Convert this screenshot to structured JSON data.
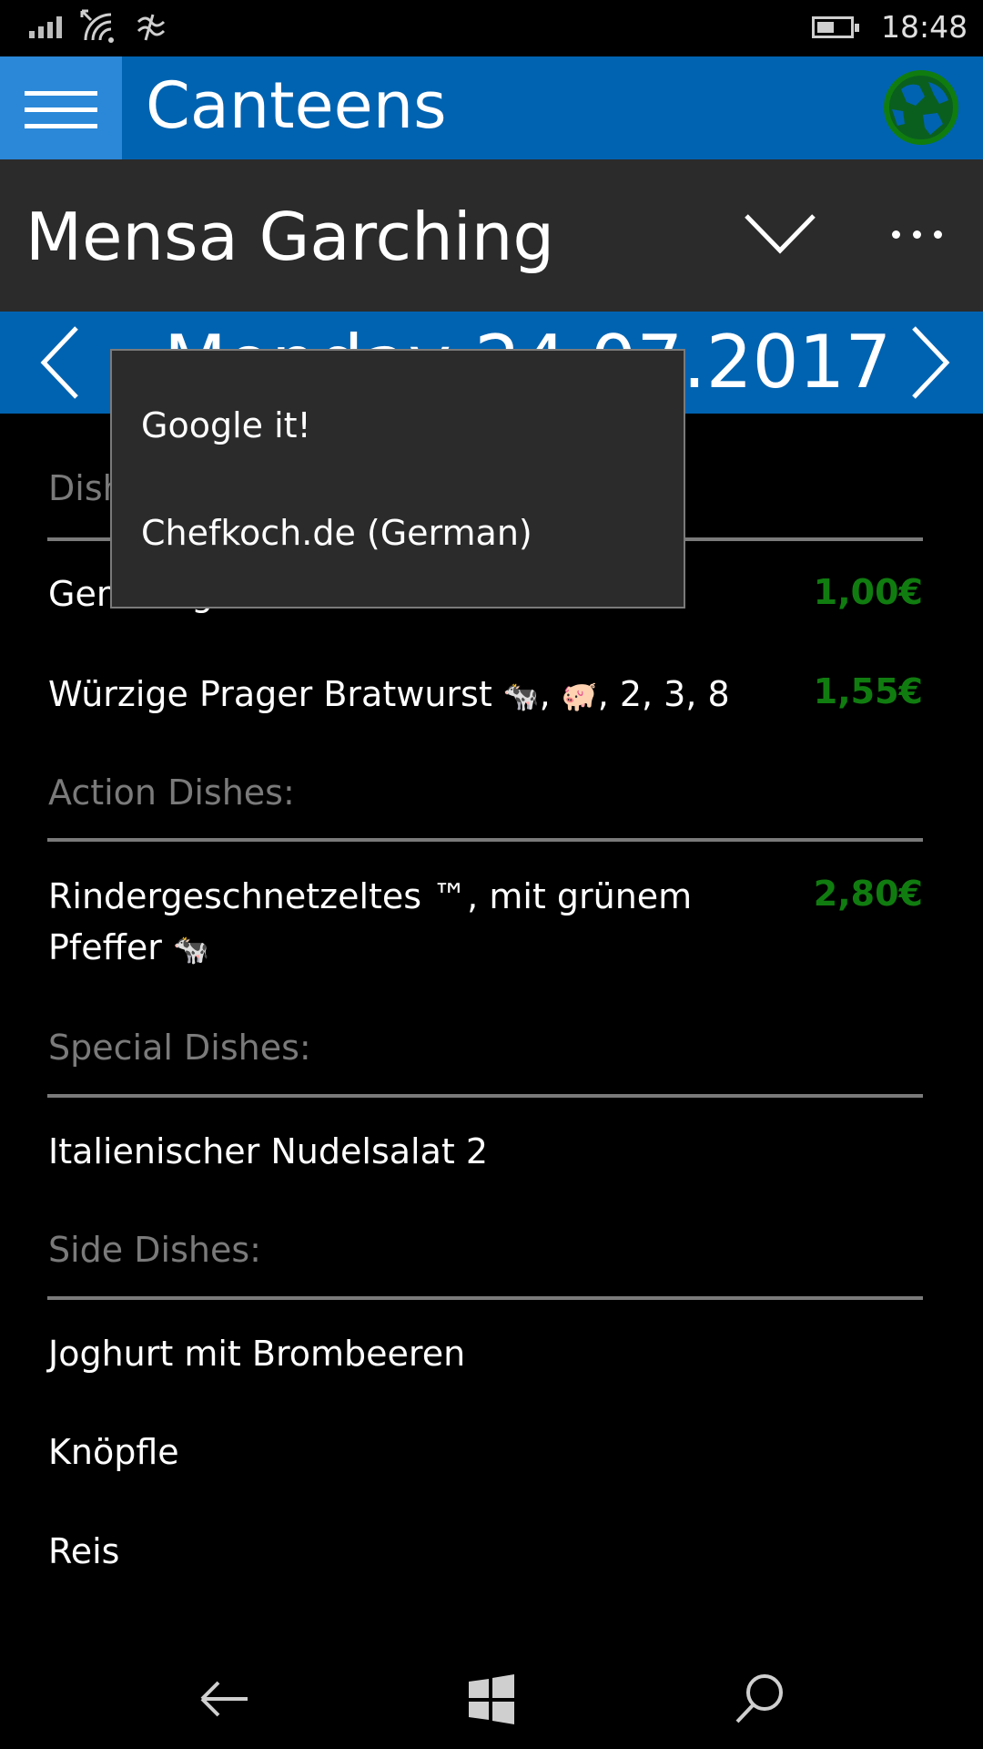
{
  "status_bar": {
    "time": "18:48",
    "battery_level": 0.45,
    "icons": [
      "signal-icon",
      "wifi-icon",
      "data-saver-icon",
      "battery-icon"
    ]
  },
  "header": {
    "title": "Canteens",
    "menu_icon": "hamburger-icon",
    "globe_icon": "globe-icon"
  },
  "canteen": {
    "name": "Mensa Garching",
    "dropdown_icon": "chevron-down-icon",
    "more_icon": "more-icon"
  },
  "date_bar": {
    "date": "Monday 24.07.2017",
    "prev_icon": "chevron-left-icon",
    "next_icon": "chevron-right-icon"
  },
  "popup_menu": {
    "items": [
      "Google it!",
      "Chefkoch.de (German)"
    ]
  },
  "sections": [
    {
      "title": "Dishes:",
      "dishes": [
        {
          "name": "Gemüsegratin",
          "price": "1,00€"
        },
        {
          "name": "Würzige Prager Bratwurst",
          "tags": [
            "🐄",
            "🐖"
          ],
          "suffix": ", 2, 3, 8",
          "price": "1,55€"
        }
      ]
    },
    {
      "title": "Action Dishes:",
      "dishes": [
        {
          "name_line1": "Rindergeschnetzeltes ™,  mit grünem",
          "name_line2": "Pfeffer",
          "tags": [
            "🐄"
          ],
          "price": "2,80€"
        }
      ]
    },
    {
      "title": "Special Dishes:",
      "dishes": [
        {
          "name": "Italienischer Nudelsalat 2"
        }
      ]
    },
    {
      "title": "Side Dishes:",
      "dishes": [
        {
          "name": "Joghurt mit Brombeeren"
        },
        {
          "name": "Knöpfle"
        },
        {
          "name": "Reis"
        }
      ]
    }
  ],
  "colors": {
    "accent": "#0063b1",
    "accent_light": "#2b88d8",
    "price": "#107c10",
    "section": "#7a7a7a",
    "bar_dark": "#2b2b2b"
  },
  "nav_bar": {
    "icons": [
      "back-icon",
      "windows-icon",
      "search-icon"
    ]
  }
}
